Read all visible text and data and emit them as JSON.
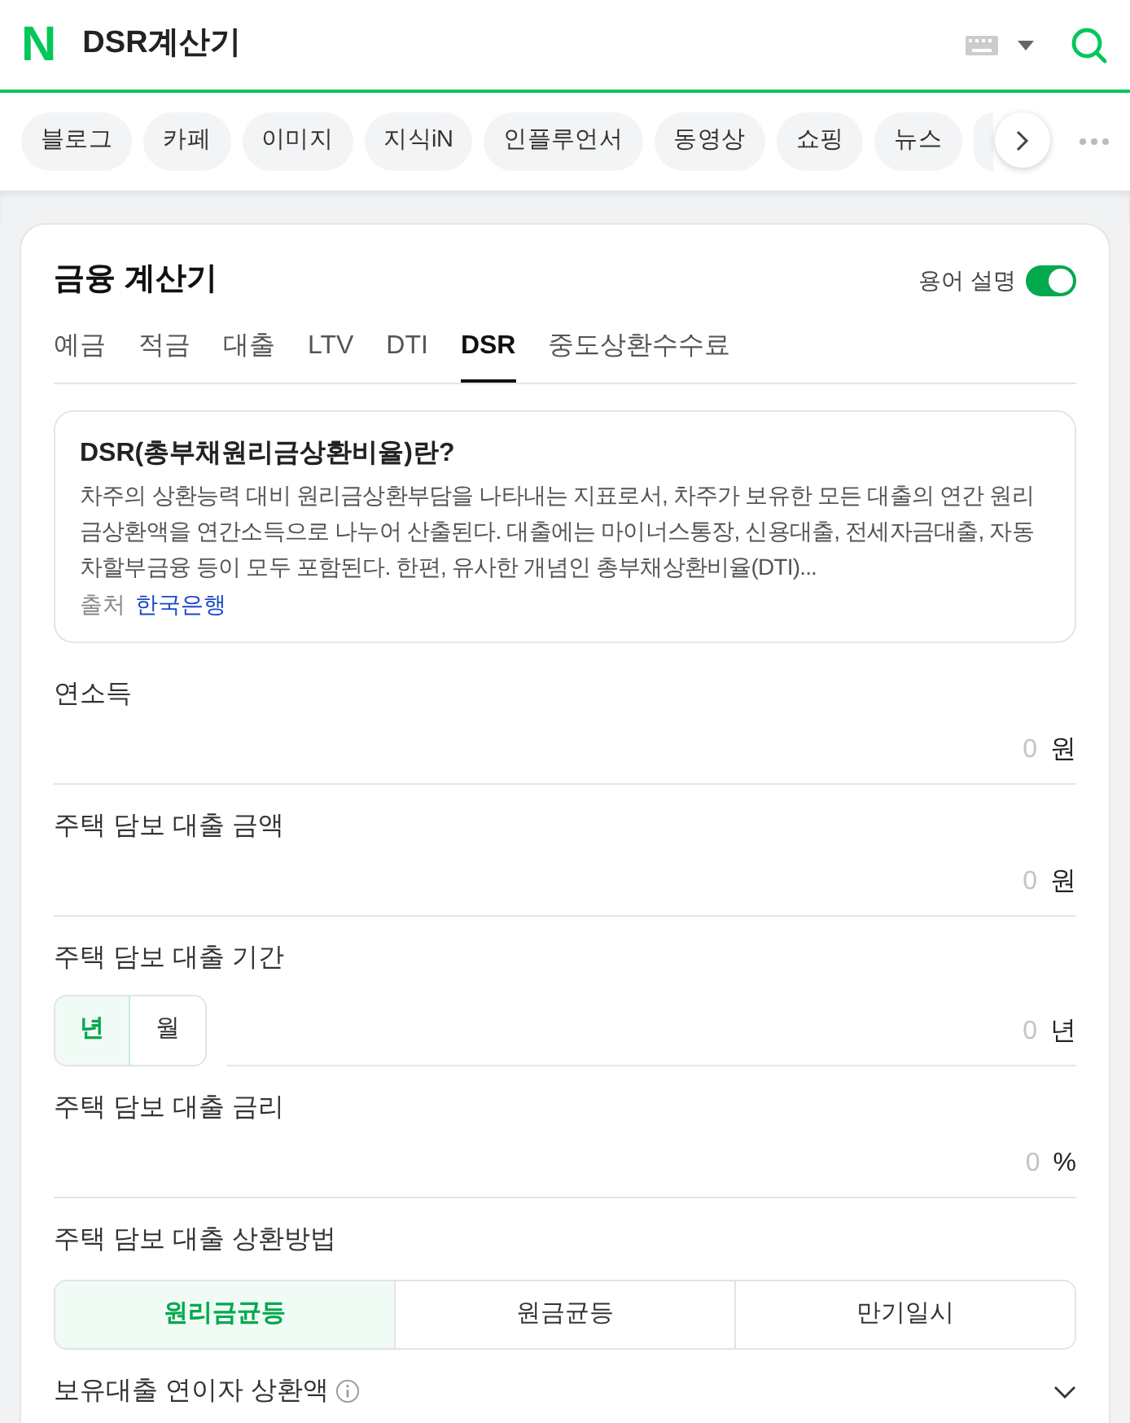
{
  "header": {
    "logo": "N",
    "query": "DSR계산기"
  },
  "chips": [
    {
      "label": "블로그"
    },
    {
      "label": "카페"
    },
    {
      "label": "이미지"
    },
    {
      "label": "지식iN"
    },
    {
      "label": "인플루언서"
    },
    {
      "label": "동영상"
    },
    {
      "label": "쇼핑"
    },
    {
      "label": "뉴스"
    },
    {
      "kind": "hidden"
    }
  ],
  "card": {
    "title": "금융 계산기",
    "glossary": {
      "label": "용어 설명",
      "on": true
    },
    "tabs": [
      {
        "label": "예금",
        "selected": false
      },
      {
        "label": "적금",
        "selected": false
      },
      {
        "label": "대출",
        "selected": false
      },
      {
        "label": "LTV",
        "selected": false
      },
      {
        "label": "DTI",
        "selected": false
      },
      {
        "label": "DSR",
        "selected": true
      },
      {
        "label": "중도상환수수료",
        "selected": false
      }
    ],
    "info": {
      "title": "DSR(총부채원리금상환비율)란?",
      "text": "차주의 상환능력 대비 원리금상환부담을 나타내는 지표로서, 차주가 보유한 모든 대출의 연간 원리금상환액을 연간소득으로 나누어 산출된다. 대출에는 마이너스통장, 신용대출, 전세자금대출, 자동차할부금융 등이 모두 포함된다. 한편, 유사한 개념인 총부채상환비율(DTI)...",
      "source_label": "출처",
      "source_link": "한국은행"
    },
    "fields": [
      {
        "kind": "input",
        "label": "연소득",
        "placeholder": "0",
        "unit": "원"
      },
      {
        "kind": "input",
        "label": "주택 담보 대출 금액",
        "placeholder": "0",
        "unit": "원"
      },
      {
        "kind": "period",
        "label": "주택 담보 대출 기간",
        "options": [
          {
            "label": "년",
            "selected": true
          },
          {
            "label": "월",
            "selected": false
          }
        ],
        "placeholder": "0",
        "unit": "년"
      },
      {
        "kind": "input",
        "label": "주택 담보 대출 금리",
        "placeholder": "0",
        "unit": "%"
      },
      {
        "kind": "segmented",
        "label": "주택 담보 대출 상환방법",
        "options": [
          {
            "label": "원리금균등",
            "selected": true
          },
          {
            "label": "원금균등",
            "selected": false
          },
          {
            "label": "만기일시",
            "selected": false
          }
        ]
      },
      {
        "kind": "expander",
        "label": "보유대출 연이자 상환액",
        "expanded": false
      }
    ]
  }
}
